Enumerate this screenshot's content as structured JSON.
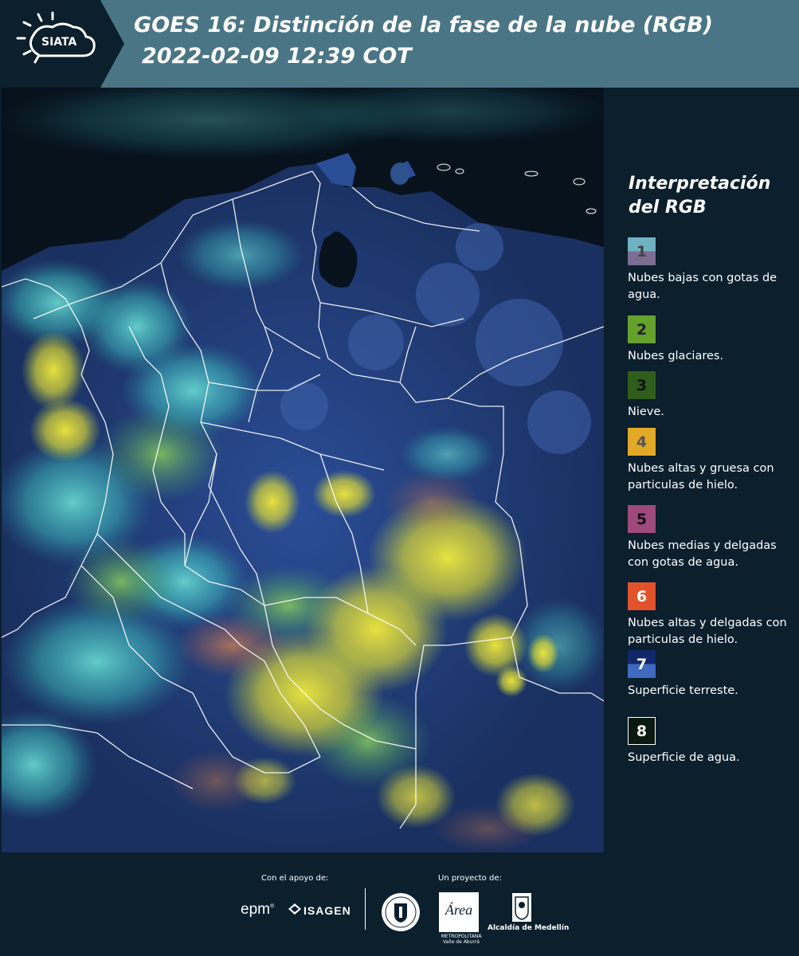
{
  "header": {
    "logo_text": "SIATA",
    "title_line1": "GOES 16: Distinción de la fase de la nube (RGB)",
    "title_line2": "2022-02-09 12:39 COT"
  },
  "legend": {
    "title_line1": "Interpretación",
    "title_line2": "del RGB",
    "items": [
      {
        "num": "1",
        "label": "Nubes bajas con gotas de agua.",
        "color_top": "#6fb2c4",
        "color_bottom": "#7b6e92",
        "num_color": "#444444"
      },
      {
        "num": "2",
        "label": "Nubes glaciares.",
        "color_top": "#64a12d",
        "color_bottom": "#64a12d",
        "num_color": "#222222"
      },
      {
        "num": "3",
        "label": "Nieve.",
        "color_top": "#2f5e1c",
        "color_bottom": "#2f5e1c",
        "num_color": "#111111"
      },
      {
        "num": "4",
        "label": "Nubes altas y gruesa con particulas de hielo.",
        "color_top": "#e2a926",
        "color_bottom": "#e2a926",
        "num_color": "#555555"
      },
      {
        "num": "5",
        "label": "Nubes medias y delgadas con gotas de agua.",
        "color_top": "#9e4a7e",
        "color_bottom": "#9e4a7e",
        "num_color": "#111111"
      },
      {
        "num": "6",
        "label": "Nubes altas y delgadas con particulas de hielo.",
        "color_top": "#e2522b",
        "color_bottom": "#e2522b",
        "num_color": "#ffffff"
      },
      {
        "num": "7",
        "label": "Superficie terreste.",
        "color_top": "#11276a",
        "color_bottom": "#3f6ac0",
        "num_color": "#ffffff"
      },
      {
        "num": "8",
        "label": "Superficie de agua.",
        "color_top": "#0a1a10",
        "color_bottom": "#0a1a10",
        "num_color": "#ffffff"
      }
    ]
  },
  "footer": {
    "support_label": "Con el apoyo de:",
    "project_label": "Un proyecto de:",
    "epm_text": "epm",
    "isagen_text": "ISAGEN",
    "area_text_line1": "METROPOLITANA",
    "area_text_line2": "Valle de Aburrá",
    "area_logo_text": "Área",
    "alcaldia_text": "Alcaldía de Medellín"
  },
  "colors": {
    "header_bg": "#4a7585",
    "page_bg": "#0b1f2d",
    "ocean": "#07121c",
    "land_blue": "#1f3a7a",
    "cloud_yellow": "#e8e23c",
    "cloud_cyan": "#56d8d8"
  }
}
